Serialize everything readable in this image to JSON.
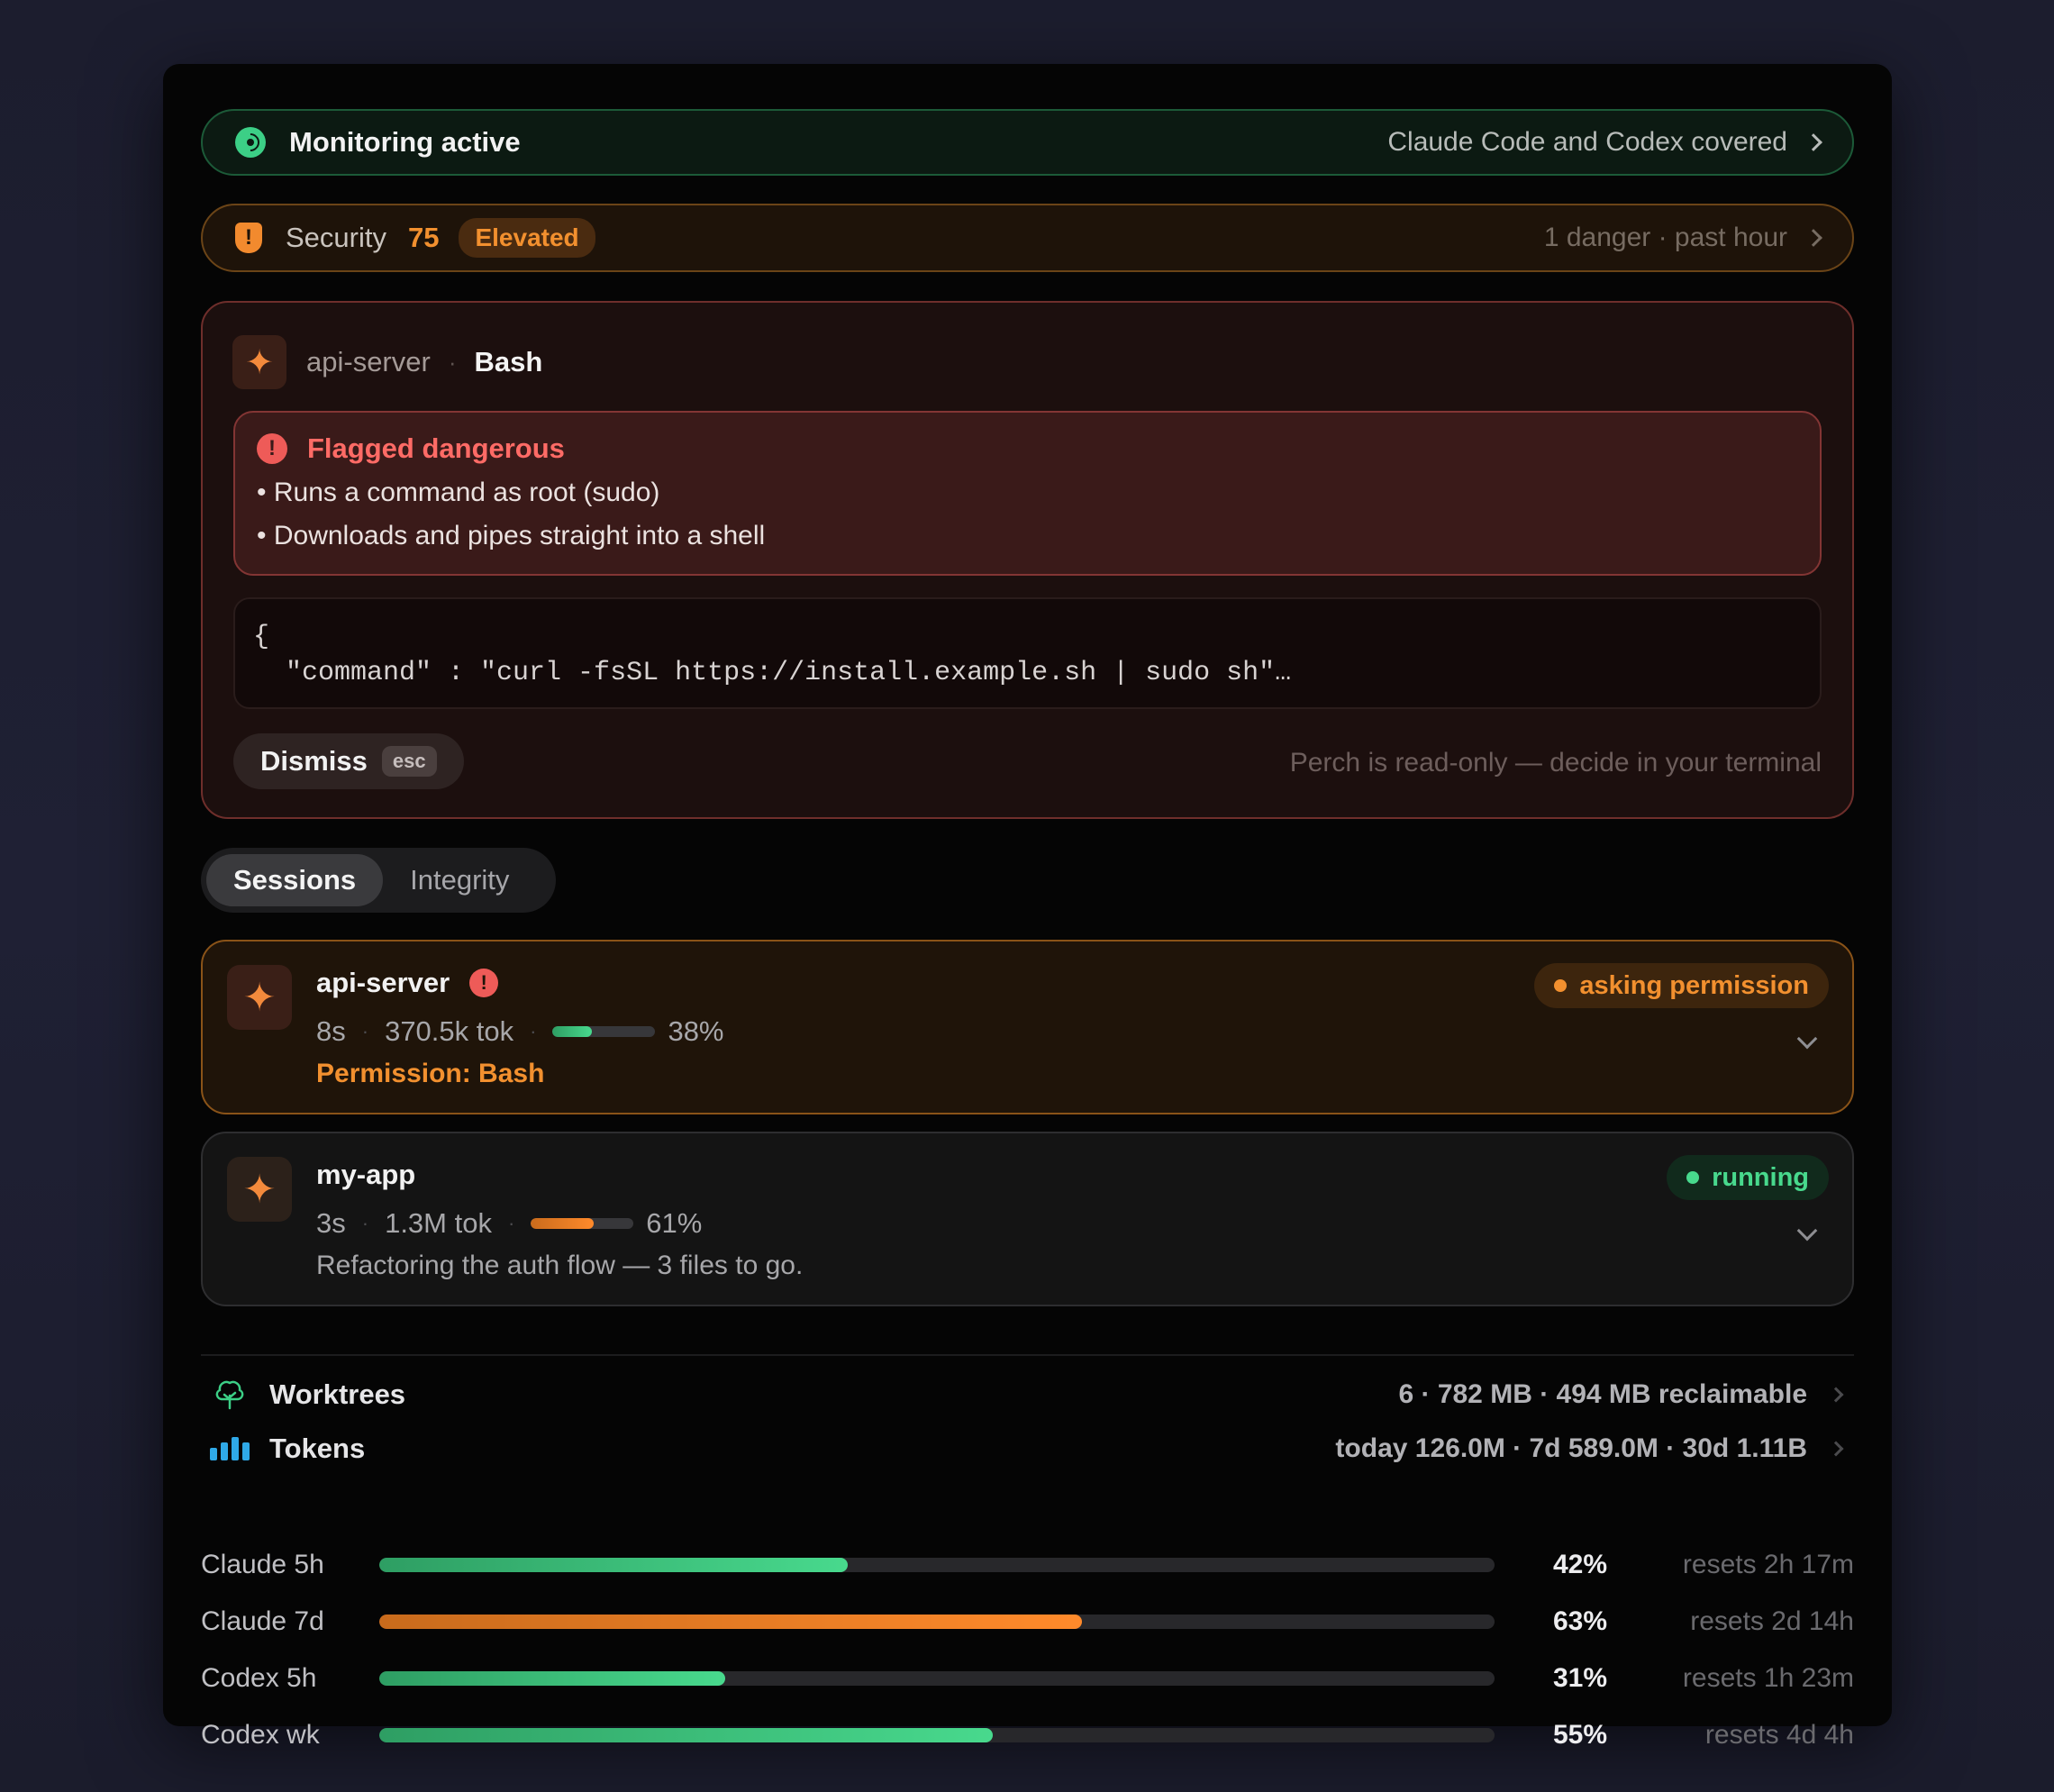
{
  "colors": {
    "green": "#3ccf86",
    "orange": "#f2902f",
    "danger": "#ff6b66",
    "accent_blue": "#2fa9e8"
  },
  "monitor": {
    "icon": "broadcast-icon",
    "title": "Monitoring active",
    "coverage": "Claude Code and Codex covered"
  },
  "security": {
    "icon": "shield-icon",
    "label": "Security",
    "score": "75",
    "level": "Elevated",
    "summary": "1 danger · past hour"
  },
  "alert": {
    "project": "api-server",
    "separator": "·",
    "tool": "Bash",
    "danger_title": "Flagged dangerous",
    "reasons": [
      "Runs a command as root (sudo)",
      "Downloads and pipes straight into a shell"
    ],
    "code_open": "{",
    "code_line": "  \"command\" : \"curl -fsSL https://install.example.sh | sudo sh\"…",
    "dismiss_label": "Dismiss",
    "dismiss_key": "esc",
    "note": "Perch is read-only — decide in your terminal"
  },
  "tabs": [
    {
      "label": "Sessions",
      "active": true
    },
    {
      "label": "Integrity",
      "active": false
    }
  ],
  "sessions": [
    {
      "name": "api-server",
      "elapsed": "8s",
      "tokens": "370.5k tok",
      "context_pct": 38,
      "context_label": "38%",
      "detail": "Permission: Bash",
      "status": "asking permission"
    },
    {
      "name": "my-app",
      "elapsed": "3s",
      "tokens": "1.3M tok",
      "context_pct": 61,
      "context_label": "61%",
      "detail": "Refactoring the auth flow — 3 files to go.",
      "status": "running"
    }
  ],
  "footer": {
    "worktrees": {
      "icon": "tree-icon",
      "label": "Worktrees",
      "value": "6 · 782 MB · 494 MB reclaimable"
    },
    "tokens": {
      "icon": "bar-chart-icon",
      "label": "Tokens",
      "value": "today 126.0M · 7d 589.0M · 30d 1.11B"
    }
  },
  "usage": [
    {
      "label": "Claude 5h",
      "pct": 42,
      "pct_label": "42%",
      "reset": "resets 2h 17m",
      "color": "green"
    },
    {
      "label": "Claude 7d",
      "pct": 63,
      "pct_label": "63%",
      "reset": "resets 2d 14h",
      "color": "orange"
    },
    {
      "label": "Codex 5h",
      "pct": 31,
      "pct_label": "31%",
      "reset": "resets 1h 23m",
      "color": "green"
    },
    {
      "label": "Codex wk",
      "pct": 55,
      "pct_label": "55%",
      "reset": "resets 4d 4h",
      "color": "green"
    }
  ]
}
